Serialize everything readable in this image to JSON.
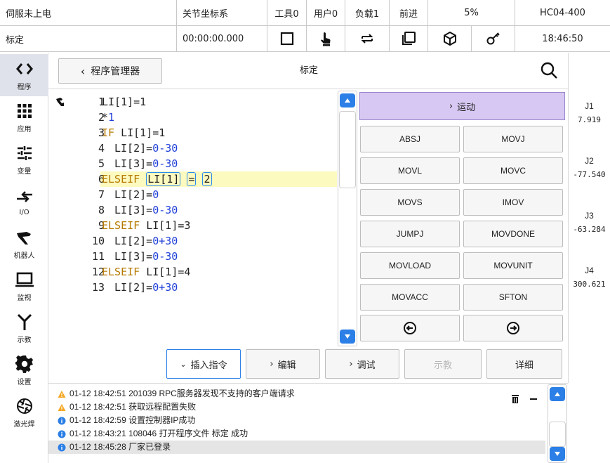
{
  "status_row1": {
    "servo": "伺服未上电",
    "coord": "关节坐标系",
    "tool": "工具0",
    "user": "用户0",
    "load": "负载1",
    "dir": "前进",
    "speed": "5%",
    "model": "HC04-400"
  },
  "status_row2": {
    "program": "标定",
    "timer": "00:00:00.000",
    "icons": [
      "stop-square-icon",
      "hand-teach-icon",
      "loop-icon",
      "copy-window-icon",
      "cube-icon",
      "key-icon"
    ],
    "clock": "18:46:50"
  },
  "nav": [
    {
      "label": "程序",
      "icon": "code-brackets-icon",
      "active": true
    },
    {
      "label": "应用",
      "icon": "app-grid-icon",
      "active": false
    },
    {
      "label": "变量",
      "icon": "sliders-icon",
      "active": false
    },
    {
      "label": "I/O",
      "icon": "io-arrows-icon",
      "active": false
    },
    {
      "label": "机器人",
      "icon": "robot-arm-icon",
      "active": false
    },
    {
      "label": "监视",
      "icon": "laptop-icon",
      "active": false
    },
    {
      "label": "示教",
      "icon": "teach-pendant-icon",
      "active": false
    },
    {
      "label": "设置",
      "icon": "gear-icon",
      "active": false
    },
    {
      "label": "激光焊",
      "icon": "aperture-icon",
      "active": false
    }
  ],
  "header": {
    "back_label": "程序管理器",
    "title": "标定"
  },
  "code_lines": [
    {
      "n": "1",
      "text": "LI[1]=1"
    },
    {
      "n": "2",
      "text": "*1"
    },
    {
      "n": "3",
      "text": "IF LI[1]=1"
    },
    {
      "n": "4",
      "text": "LI[2]=0-30"
    },
    {
      "n": "5",
      "text": "LI[3]=0-30"
    },
    {
      "n": "6",
      "text": "ELSEIF LI[1]=2"
    },
    {
      "n": "7",
      "text": "LI[2]=0"
    },
    {
      "n": "8",
      "text": "LI[3]=0-30"
    },
    {
      "n": "9",
      "text": "ELSEIF LI[1]=3"
    },
    {
      "n": "10",
      "text": "LI[2]=0+30"
    },
    {
      "n": "11",
      "text": "LI[3]=0-30"
    },
    {
      "n": "12",
      "text": "ELSEIF LI[1]=4"
    },
    {
      "n": "13",
      "text": "LI[2]=0+30"
    }
  ],
  "commands": {
    "header": "运动",
    "buttons": [
      "ABSJ",
      "MOVJ",
      "MOVL",
      "MOVC",
      "MOVS",
      "IMOV",
      "JUMPJ",
      "MOVDONE",
      "MOVLOAD",
      "MOVUNIT",
      "MOVACC",
      "SFTON"
    ]
  },
  "joints": [
    {
      "name": "J1",
      "value": "7.919"
    },
    {
      "name": "J2",
      "value": "-77.540"
    },
    {
      "name": "J3",
      "value": "-63.284"
    },
    {
      "name": "J4",
      "value": "300.621"
    }
  ],
  "toolbar": {
    "insert": "插入指令",
    "edit": "编辑",
    "debug": "调试",
    "teach": "示教",
    "detail": "详细"
  },
  "log": [
    {
      "type": "warning",
      "text": "01-12 18:42:51 201039 RPC服务器发现不支持的客户端请求"
    },
    {
      "type": "warning",
      "text": "01-12 18:42:51 获取远程配置失败"
    },
    {
      "type": "info",
      "text": "01-12 18:42:59 设置控制器IP成功"
    },
    {
      "type": "info",
      "text": "01-12 18:43:21 108046 打开程序文件 标定 成功"
    },
    {
      "type": "info",
      "text": "01-12 18:45:28 厂家已登录"
    }
  ],
  "colors": {
    "accent": "#2b7fe6",
    "motion_header": "#d7c8f3",
    "highlight": "#fdfac0",
    "keyword": "#b57a00",
    "number": "#1e3fd8",
    "warning": "#f5a623"
  }
}
